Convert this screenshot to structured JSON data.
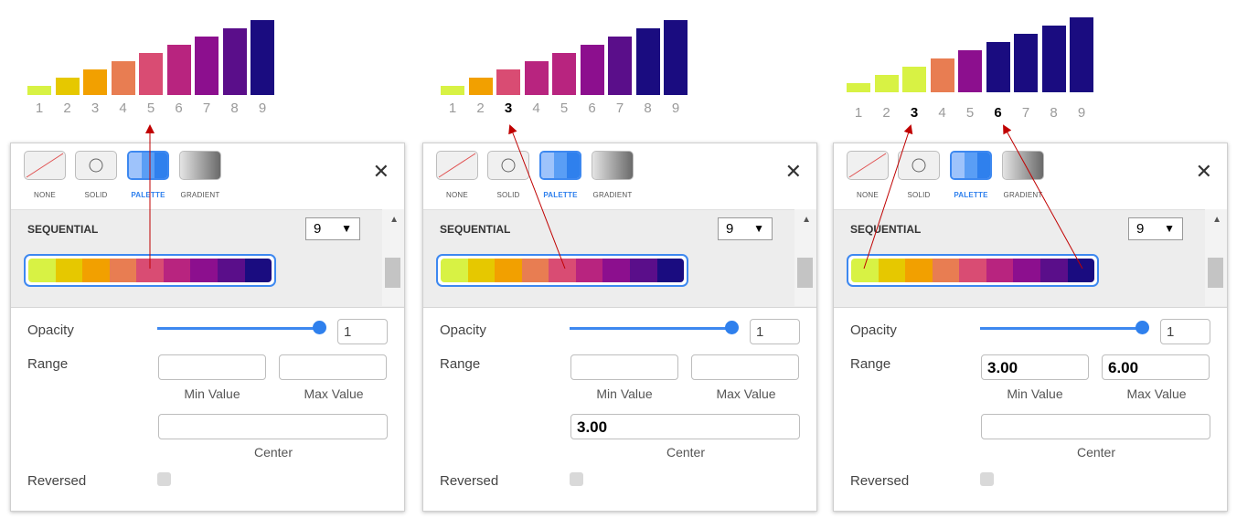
{
  "palette_colors": [
    "#d8f244",
    "#e6c800",
    "#f2a000",
    "#e87d52",
    "#d94c73",
    "#b8247f",
    "#8c0f8e",
    "#5a0e8a",
    "#1a0c80"
  ],
  "bar_ticks": [
    "1",
    "2",
    "3",
    "4",
    "5",
    "6",
    "7",
    "8",
    "9"
  ],
  "panel": {
    "tools": [
      {
        "label": "NONE"
      },
      {
        "label": "SOLID"
      },
      {
        "label": "PALETTE"
      },
      {
        "label": "GRADIENT"
      }
    ],
    "close_symbol": "✕",
    "section_label": "SEQUENTIAL",
    "count_value": "9",
    "count_arrow": "▼",
    "scroll_up": "▲",
    "opacity_label": "Opacity",
    "opacity_value": "1",
    "range_label": "Range",
    "min_caption": "Min Value",
    "max_caption": "Max Value",
    "center_caption": "Center",
    "reversed_label": "Reversed"
  },
  "variants": [
    {
      "bar_heights": [
        10,
        19,
        28,
        37,
        46,
        55,
        64,
        73,
        82
      ],
      "bar_color_index": [
        0,
        1,
        2,
        3,
        4,
        5,
        6,
        7,
        8
      ],
      "bold_ticks": [],
      "min_value": "",
      "max_value": "",
      "center_value": ""
    },
    {
      "bar_heights": [
        10,
        19,
        28,
        37,
        46,
        55,
        64,
        73,
        82
      ],
      "bar_color_index": [
        0,
        2,
        4,
        5,
        5,
        6,
        7,
        8,
        8
      ],
      "bold_ticks": [
        "3"
      ],
      "min_value": "",
      "max_value": "",
      "center_value": "3.00"
    },
    {
      "bar_heights": [
        10,
        19,
        28,
        37,
        46,
        55,
        64,
        73,
        82
      ],
      "bar_color_index": [
        0,
        0,
        0,
        3,
        6,
        8,
        8,
        8,
        8
      ],
      "bold_ticks": [
        "3",
        "6"
      ],
      "min_value": "3.00",
      "max_value": "6.00",
      "center_value": ""
    }
  ]
}
